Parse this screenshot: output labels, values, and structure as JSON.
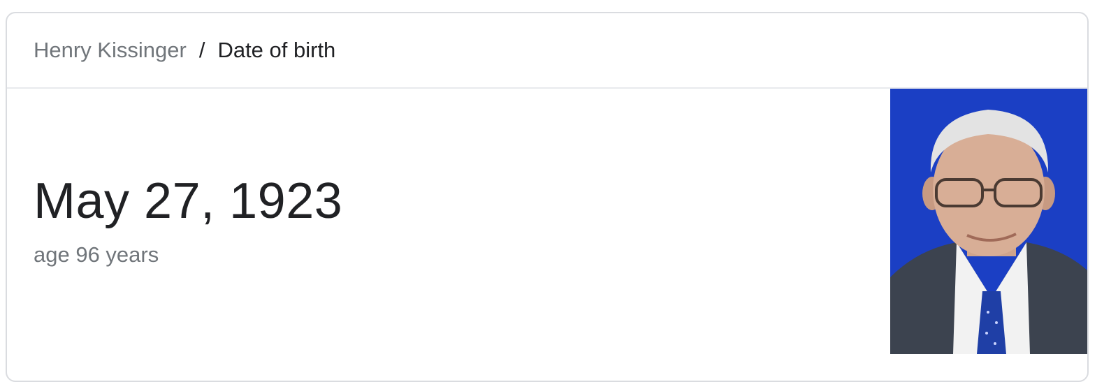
{
  "breadcrumb": {
    "entity": "Henry Kissinger",
    "separator": "/",
    "attribute": "Date of birth"
  },
  "answer": {
    "date": "May 27, 1923",
    "age": "age 96 years"
  },
  "photo": {
    "background_color": "#1b3fc4",
    "subject": "portrait-photo"
  }
}
